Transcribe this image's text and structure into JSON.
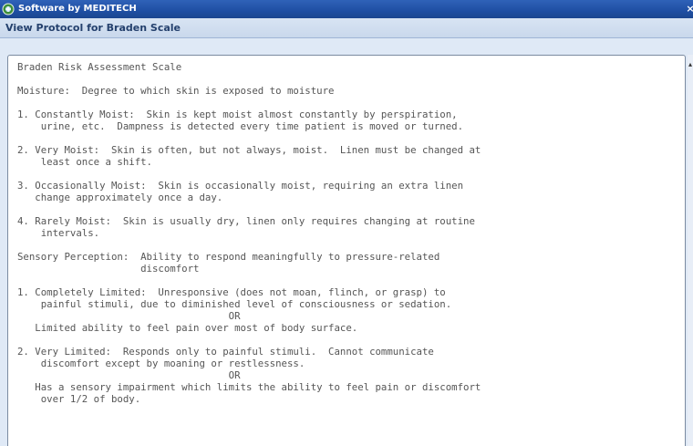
{
  "window": {
    "title": "Software by MEDITECH",
    "icon": "meditech-icon",
    "close_glyph": "×"
  },
  "header": {
    "title": "View Protocol for Braden Scale"
  },
  "protocol": {
    "lines": [
      "Braden Risk Assessment Scale",
      "",
      "Moisture:  Degree to which skin is exposed to moisture",
      "",
      "1. Constantly Moist:  Skin is kept moist almost constantly by perspiration,",
      "    urine, etc.  Dampness is detected every time patient is moved or turned.",
      "",
      "2. Very Moist:  Skin is often, but not always, moist.  Linen must be changed at",
      "    least once a shift.",
      "",
      "3. Occasionally Moist:  Skin is occasionally moist, requiring an extra linen",
      "   change approximately once a day.",
      "",
      "4. Rarely Moist:  Skin is usually dry, linen only requires changing at routine",
      "    intervals.",
      "",
      "Sensory Perception:  Ability to respond meaningfully to pressure-related",
      "                     discomfort",
      "",
      "1. Completely Limited:  Unresponsive (does not moan, flinch, or grasp) to",
      "    painful stimuli, due to diminished level of consciousness or sedation.",
      "                                    OR",
      "   Limited ability to feel pain over most of body surface.",
      "",
      "2. Very Limited:  Responds only to painful stimuli.  Cannot communicate",
      "    discomfort except by moaning or restlessness.",
      "                                    OR",
      "   Has a sensory impairment which limits the ability to feel pain or discomfort",
      "    over 1/2 of body."
    ]
  },
  "scrollbar": {
    "up_glyph": "▴"
  }
}
